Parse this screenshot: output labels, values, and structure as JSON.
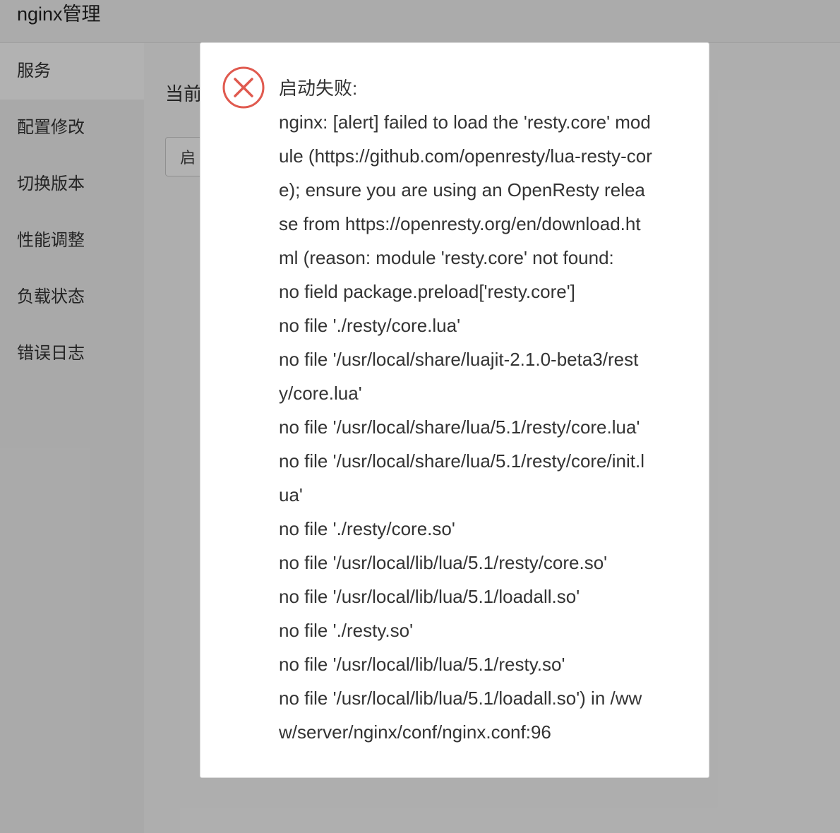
{
  "app": {
    "title": "nginx管理"
  },
  "sidebar": {
    "items": [
      {
        "label": "服务"
      },
      {
        "label": "配置修改"
      },
      {
        "label": "切换版本"
      },
      {
        "label": "性能调整"
      },
      {
        "label": "负载状态"
      },
      {
        "label": "错误日志"
      }
    ]
  },
  "main": {
    "current_label": "当前",
    "start_button_label": "启"
  },
  "dialog": {
    "icon": "error-circle-x-icon",
    "icon_color": "#e05a4f",
    "heading": "启动失败:",
    "lines": [
      "nginx: [alert] failed to load the 'resty.core' mod",
      "ule (https://github.com/openresty/lua-resty-cor",
      "e); ensure you are using an OpenResty relea",
      "se from https://openresty.org/en/download.ht",
      "ml (reason: module 'resty.core' not found:",
      "no field package.preload['resty.core']",
      "no file './resty/core.lua'",
      "no file '/usr/local/share/luajit-2.1.0-beta3/rest",
      "y/core.lua'",
      "no file '/usr/local/share/lua/5.1/resty/core.lua'",
      "no file '/usr/local/share/lua/5.1/resty/core/init.l",
      "ua'",
      "no file './resty/core.so'",
      "no file '/usr/local/lib/lua/5.1/resty/core.so'",
      "no file '/usr/local/lib/lua/5.1/loadall.so'",
      "no file './resty.so'",
      "no file '/usr/local/lib/lua/5.1/resty.so'",
      "no file '/usr/local/lib/lua/5.1/loadall.so') in /ww",
      "w/server/nginx/conf/nginx.conf:96"
    ]
  }
}
